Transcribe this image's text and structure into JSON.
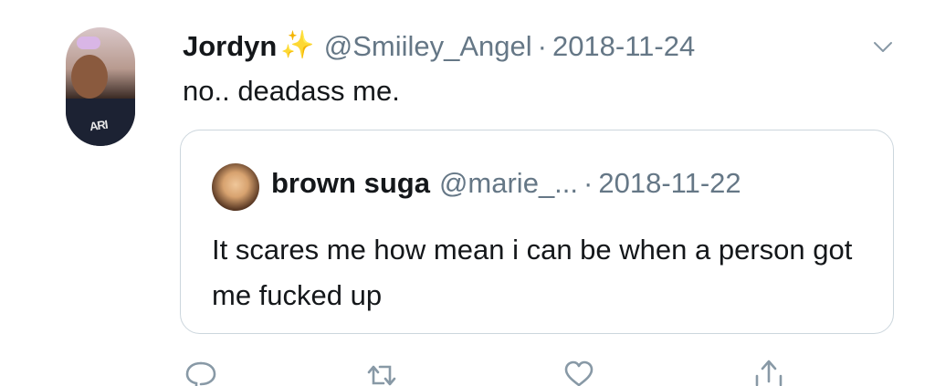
{
  "tweet": {
    "author_name": "Jordyn",
    "author_emoji": "✨",
    "handle": "@Smiiley_Angel",
    "separator": "·",
    "date": "2018-11-24",
    "text": "no.. deadass me.",
    "avatar_text": "ARI"
  },
  "quoted_tweet": {
    "author_name": "brown suga",
    "handle": "@marie_...",
    "separator": "·",
    "date": "2018-11-22",
    "text": "It scares me how mean i can be when a person got me fucked up"
  },
  "actions": [
    {
      "name": "reply",
      "icon": "reply-icon"
    },
    {
      "name": "retweet",
      "icon": "retweet-icon"
    },
    {
      "name": "like",
      "icon": "heart-icon"
    },
    {
      "name": "share",
      "icon": "share-icon"
    }
  ],
  "colors": {
    "text": "#14171a",
    "secondary": "#657786",
    "border": "#ccd6dd",
    "icon": "#657786",
    "sparkle": "#f5c542"
  }
}
